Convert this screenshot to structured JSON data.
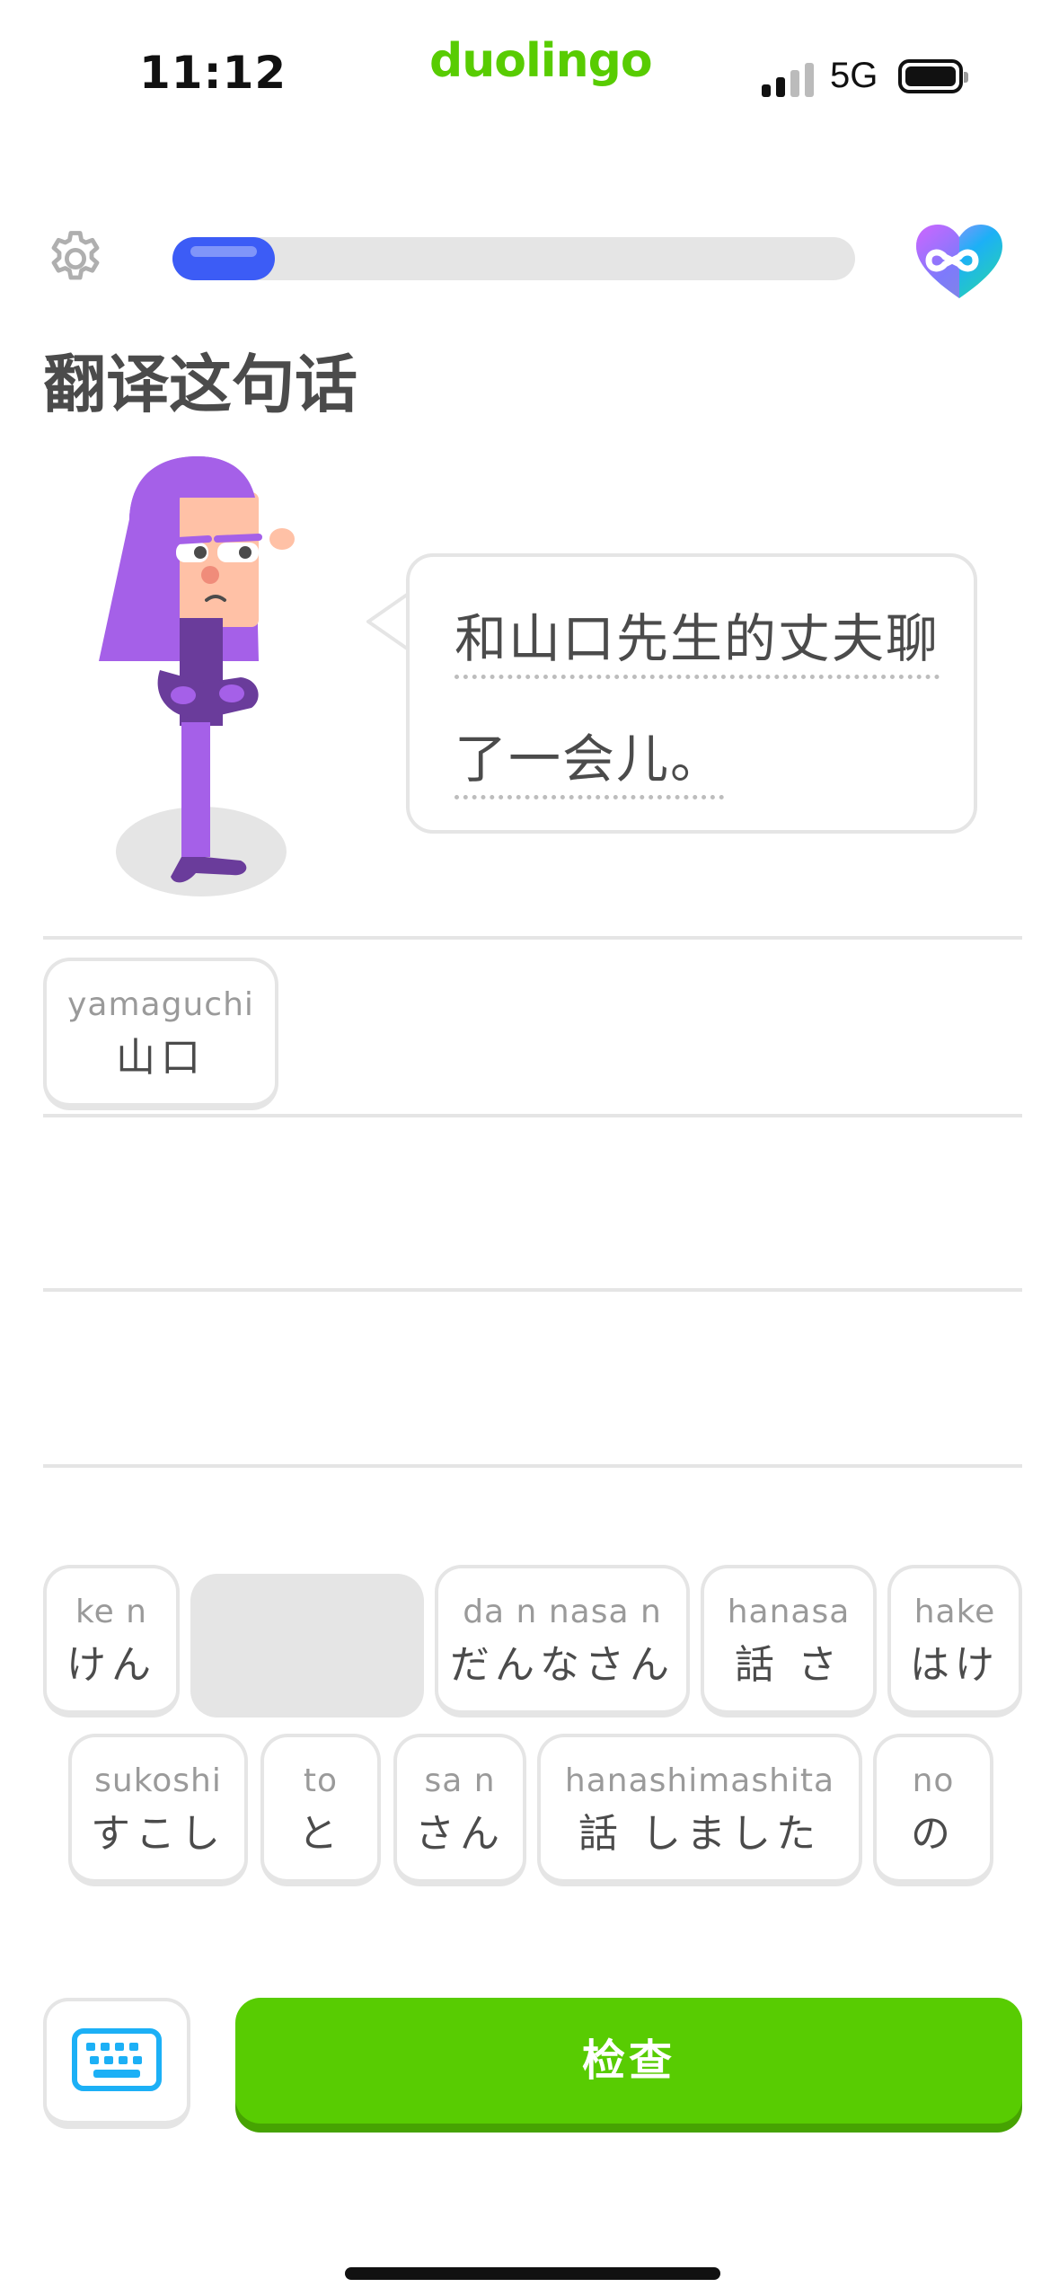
{
  "status_bar": {
    "time": "11:12",
    "brand": "duolingo",
    "network": "5G",
    "signal_icon": "signal-bars-icon",
    "battery_icon": "battery-icon"
  },
  "header": {
    "settings_icon": "gear-icon",
    "progress": 0.15,
    "hearts_icon": "infinity-heart-icon"
  },
  "lesson": {
    "title": "翻译这句话",
    "prompt_lines": [
      "和山口先生的丈夫聊",
      "了一会儿。"
    ]
  },
  "answer": {
    "selected_tiles": [
      {
        "romaji": "yamaguchi",
        "kana": "山口"
      }
    ]
  },
  "word_bank": {
    "row1": [
      {
        "romaji": "ke n",
        "kana": "けん"
      },
      {
        "romaji": "",
        "kana": "",
        "used": true
      },
      {
        "romaji": "da n nasa n",
        "kana": "だんなさん"
      },
      {
        "romaji": "hanasa",
        "kana": "話 さ"
      },
      {
        "romaji": "hake",
        "kana": "はけ"
      }
    ],
    "row2": [
      {
        "romaji": "sukoshi",
        "kana": "すこし"
      },
      {
        "romaji": "to",
        "kana": "と"
      },
      {
        "romaji": "sa n",
        "kana": "さん"
      },
      {
        "romaji": "hanashimashita",
        "kana": "話 しました"
      },
      {
        "romaji": "no",
        "kana": "の"
      }
    ]
  },
  "footer": {
    "keyboard_icon": "keyboard-icon",
    "check_label": "检查"
  },
  "colors": {
    "brand_green": "#58cc02",
    "progress_blue": "#3c5cf6",
    "tile_border": "#e5e5e5"
  }
}
